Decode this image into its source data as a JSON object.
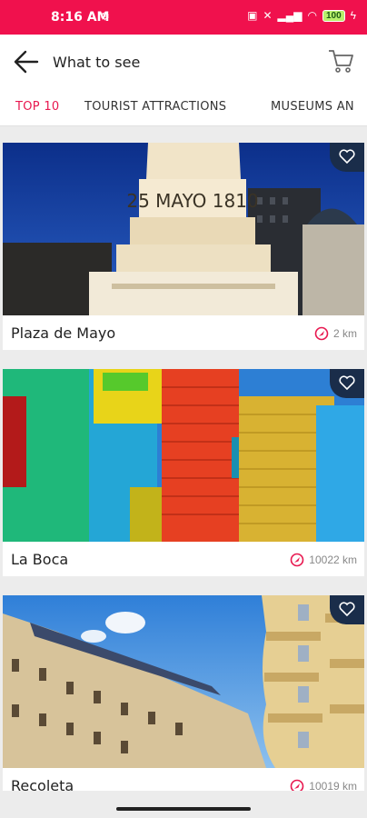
{
  "status_bar": {
    "time": "8:16 AM",
    "battery": "100"
  },
  "app_bar": {
    "title": "What to see",
    "back_icon": "arrow-left-icon",
    "cart_icon": "cart-icon"
  },
  "tabs": [
    {
      "label": "TOP 10",
      "active": true
    },
    {
      "label": "TOURIST ATTRACTIONS",
      "active": false
    },
    {
      "label": "MUSEUMS AN",
      "active": false
    }
  ],
  "places": [
    {
      "name": "Plaza de Mayo",
      "distance": "2 km",
      "sign_text": "25 MAYO 1810"
    },
    {
      "name": "La Boca",
      "distance": "10022 km"
    },
    {
      "name": "Recoleta",
      "distance": "10019 km"
    }
  ],
  "colors": {
    "accent": "#e8174f",
    "status_bar": "#f0114d",
    "fav_bg": "#1a2d4a"
  }
}
